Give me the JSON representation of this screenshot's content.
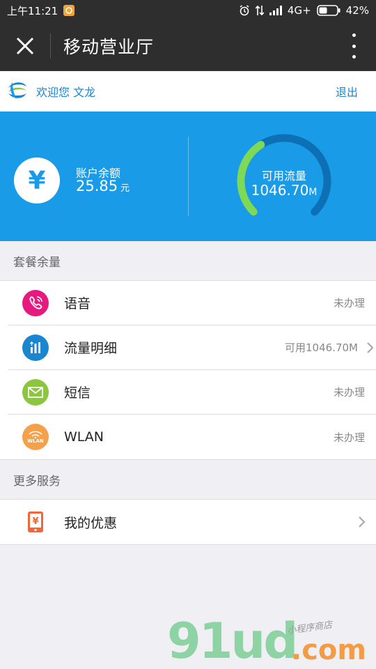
{
  "status_bar": {
    "time": "上午11:21",
    "network": "4G+",
    "battery": "42%"
  },
  "nav": {
    "title": "移动营业厅"
  },
  "welcome": {
    "text": "欢迎您 文龙",
    "logout": "退出"
  },
  "account": {
    "currency_symbol": "¥",
    "balance_label": "账户余额",
    "balance_value": "25.85",
    "balance_unit": "元"
  },
  "flow": {
    "label": "可用流量",
    "value": "1046.70",
    "unit": "M",
    "gauge_fraction": 0.38
  },
  "sections": {
    "package": {
      "title": "套餐余量",
      "items": [
        {
          "label": "语音",
          "status": "未办理",
          "icon": "phone-icon",
          "color": "#e6197e"
        },
        {
          "label": "流量明细",
          "status": "可用1046.70M",
          "icon": "data-bars-icon",
          "color": "#1a86d0"
        },
        {
          "label": "短信",
          "status": "未办理",
          "icon": "envelope-icon",
          "color": "#8cc63f"
        },
        {
          "label": "WLAN",
          "status": "未办理",
          "icon": "wifi-icon",
          "color": "#f5a04a",
          "icon_text": "WLAN"
        }
      ]
    },
    "more": {
      "title": "更多服务",
      "items": [
        {
          "label": "我的优惠",
          "icon": "coupon-icon",
          "color": "#f0673a",
          "icon_text": "¥"
        }
      ]
    }
  },
  "watermark": {
    "main": "91ud",
    "com": ".com",
    "sub": "小程序商店"
  },
  "colors": {
    "topbar": "#2e2e2e",
    "accent_blue": "#1a9be8",
    "link_blue": "#1784d6",
    "gauge_green": "#7ed957",
    "gauge_track": "#0d6fb4"
  }
}
